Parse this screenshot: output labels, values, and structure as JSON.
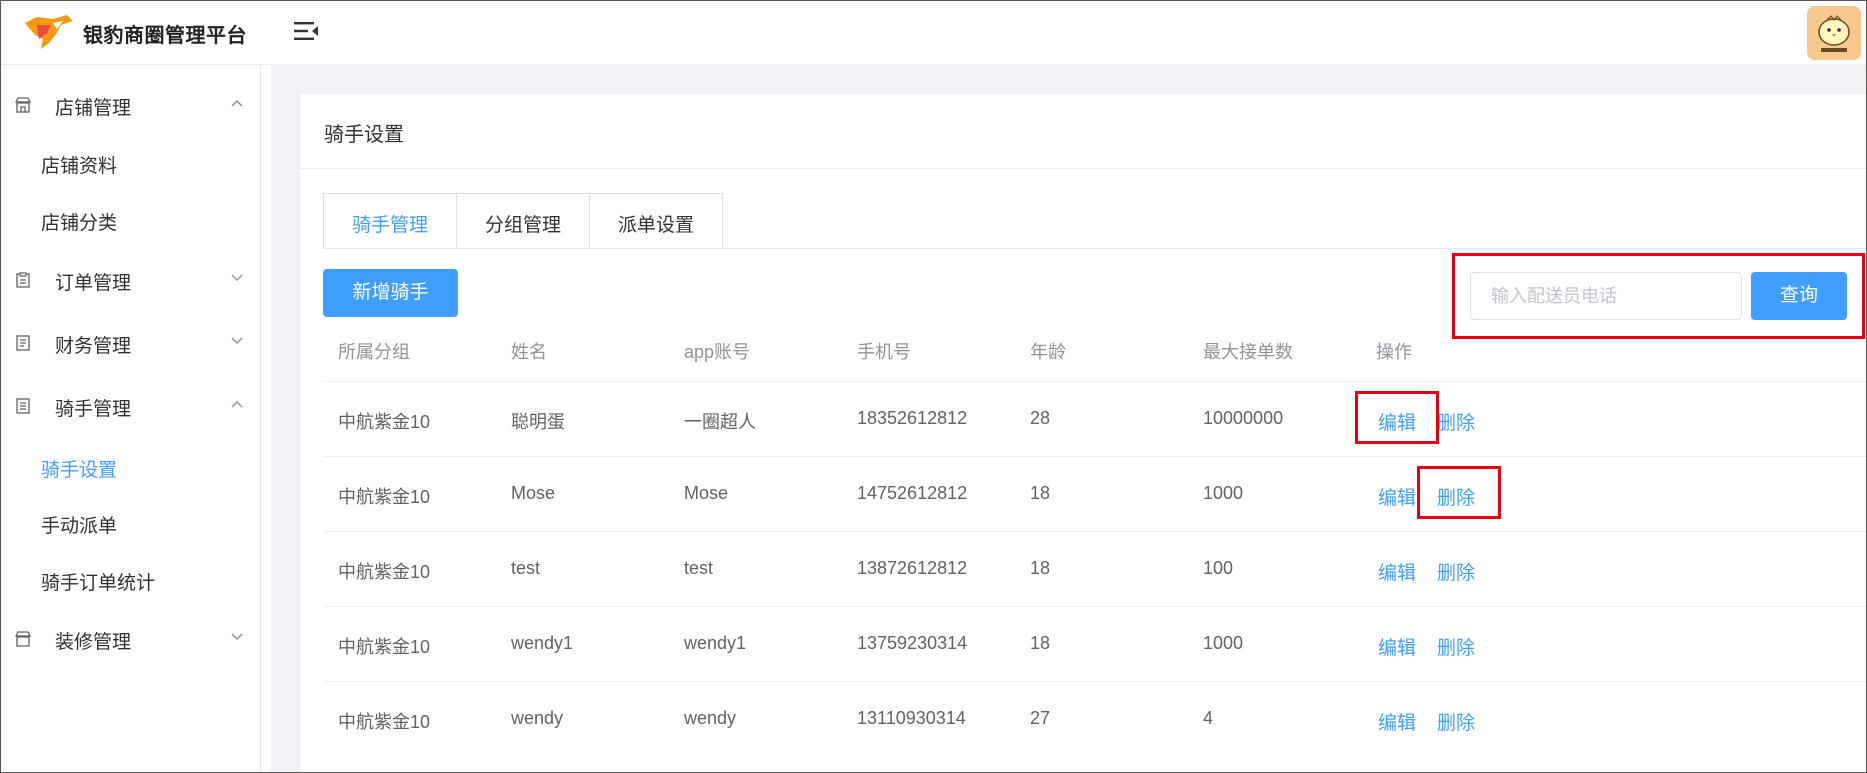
{
  "app": {
    "title": "银豹商圈管理平台"
  },
  "sidebar": {
    "groups": [
      {
        "label": "店铺管理",
        "items": [
          "店铺资料",
          "店铺分类"
        ]
      },
      {
        "label": "订单管理"
      },
      {
        "label": "财务管理"
      },
      {
        "label": "骑手管理",
        "items": [
          "骑手设置",
          "手动派单",
          "骑手订单统计"
        ],
        "active_item": "骑手设置"
      },
      {
        "label": "装修管理"
      }
    ]
  },
  "page": {
    "title": "骑手设置",
    "tabs": [
      "骑手管理",
      "分组管理",
      "派单设置"
    ],
    "active_tab": "骑手管理",
    "add_button": "新增骑手",
    "search": {
      "placeholder": "输入配送员电话",
      "button": "查询"
    }
  },
  "table": {
    "columns": [
      "所属分组",
      "姓名",
      "app账号",
      "手机号",
      "年龄",
      "最大接单数",
      "操作"
    ],
    "rows": [
      {
        "group": "中航紫金10",
        "name": "聪明蛋",
        "account": "一圈超人",
        "phone": "18352612812",
        "age": "28",
        "max_orders": "10000000"
      },
      {
        "group": "中航紫金10",
        "name": "Mose",
        "account": "Mose",
        "phone": "14752612812",
        "age": "18",
        "max_orders": "1000"
      },
      {
        "group": "中航紫金10",
        "name": "test",
        "account": "test",
        "phone": "13872612812",
        "age": "18",
        "max_orders": "100"
      },
      {
        "group": "中航紫金10",
        "name": "wendy1",
        "account": "wendy1",
        "phone": "13759230314",
        "age": "18",
        "max_orders": "1000"
      },
      {
        "group": "中航紫金10",
        "name": "wendy",
        "account": "wendy",
        "phone": "13110930314",
        "age": "27",
        "max_orders": "4"
      }
    ],
    "actions": {
      "edit": "编辑",
      "delete": "删除"
    }
  },
  "colors": {
    "primary": "#409eff",
    "highlight": "#e60012"
  }
}
